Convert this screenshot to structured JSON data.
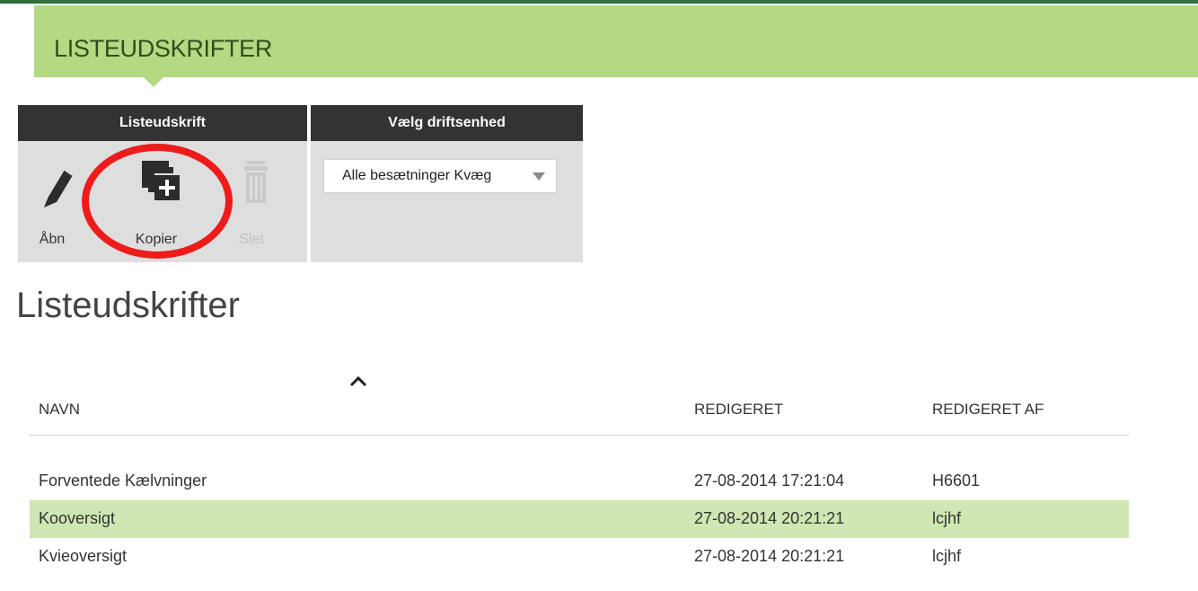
{
  "header": {
    "title": "LISTEUDSKRIFTER"
  },
  "toolbar": {
    "group_title": "Listeudskrift",
    "open_label": "Åbn",
    "copy_label": "Kopier",
    "delete_label": "Slet"
  },
  "unit_selector": {
    "title": "Vælg driftsenhed",
    "selected": "Alle besætninger Kvæg"
  },
  "page": {
    "title": "Listeudskrifter"
  },
  "table": {
    "columns": [
      "NAVN",
      "REDIGERET",
      "REDIGERET AF"
    ],
    "rows": [
      {
        "name": "Forventede Kælvninger",
        "edited": "27-08-2014 17:21:04",
        "edited_by": "H6601"
      },
      {
        "name": "Kooversigt",
        "edited": "27-08-2014 20:21:21",
        "edited_by": "lcjhf"
      },
      {
        "name": "Kvieoversigt",
        "edited": "27-08-2014 20:21:21",
        "edited_by": "lcjhf"
      }
    ]
  },
  "colors": {
    "header_band": "#b3d983",
    "selected_row": "#cfe7b2",
    "panel_header": "#333333",
    "annotation_ring": "#ee1b1b"
  },
  "icons": [
    "pencil-icon",
    "copy-plus-icon",
    "trash-icon",
    "dropdown-arrow-icon",
    "sort-ascending-icon"
  ]
}
